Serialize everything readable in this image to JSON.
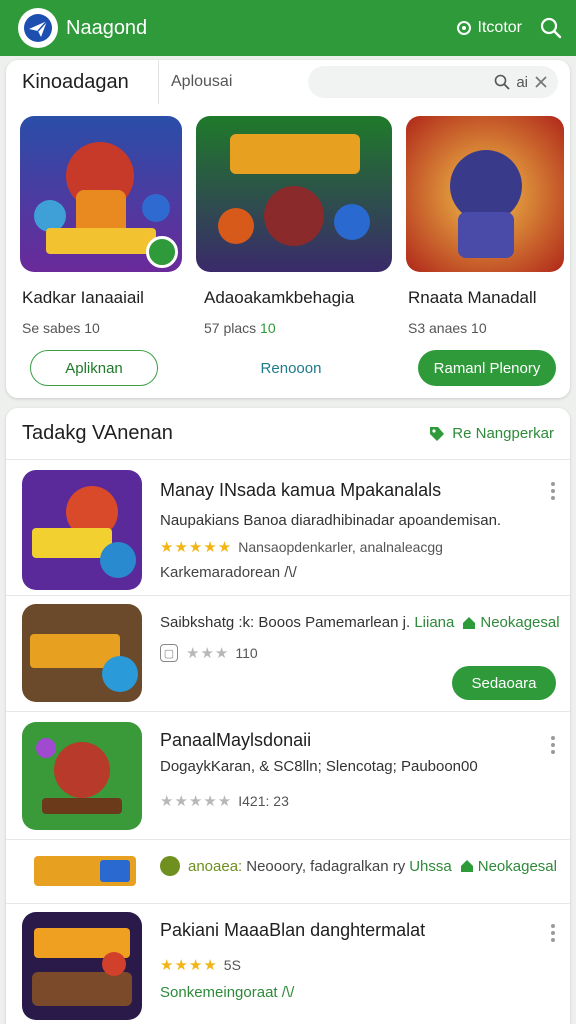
{
  "app": {
    "title": "Naagond",
    "action_label": "Itcotor",
    "logo_icon": "paper-plane-icon"
  },
  "colors": {
    "brand": "#2e9a39",
    "accent_text": "#2e8a3a",
    "star": "#f2b516"
  },
  "featured": {
    "title": "Kinoadagan",
    "tab": "Aplousai",
    "search_text": "ai",
    "items": [
      {
        "name": "Kadkar Ianaaiail",
        "meta": "Se sabes 10",
        "badge": ""
      },
      {
        "name": "Adaoakamkbehagia",
        "meta": "57 placs",
        "badge": "10"
      },
      {
        "name": "Rnaata Manadall",
        "meta": "S3 anaes 10",
        "badge": ""
      }
    ],
    "buttons": {
      "outline": "Apliknan",
      "text": "Renooon",
      "solid": "Ramanl Plenory"
    }
  },
  "list": {
    "title": "Tadakg VAnenan",
    "link_label": "Re Nangperkar",
    "rows": [
      {
        "title": "Manay INsada kamua Mpakanalals",
        "desc": "Naupakians Banoa diaradhibinadar apoandemisan.",
        "rating": "★★★★★",
        "meta": "Nansaopdenkarler, analnaleacgg",
        "sub": "Karkemaradorean /\\/"
      },
      {
        "desc": "Saibkshatg :k: Booos Pamemarlean j.",
        "desc_green": "Liiana",
        "desc_green2": "Neokagesal",
        "rating": "★★★",
        "meta": "110",
        "action": "Sedaoara"
      },
      {
        "title": "PanaalMaylsdonaii",
        "desc": "DogaykKaran, & SC8lln; Slencotag; Pauboon00",
        "rating": "★★★★★",
        "meta": "I421: 23"
      },
      {
        "ad_label": "anoaea:",
        "ad_text": "Neooory, fadagralkan ry",
        "ad_green": "Uhssa",
        "ad_green2": "Neokagesal"
      },
      {
        "title": "Pakiani MaaaBlan danghtermalat",
        "rating": "★★★★",
        "meta": "5S",
        "sub": "Sonkemeingoraat /\\/"
      }
    ]
  }
}
